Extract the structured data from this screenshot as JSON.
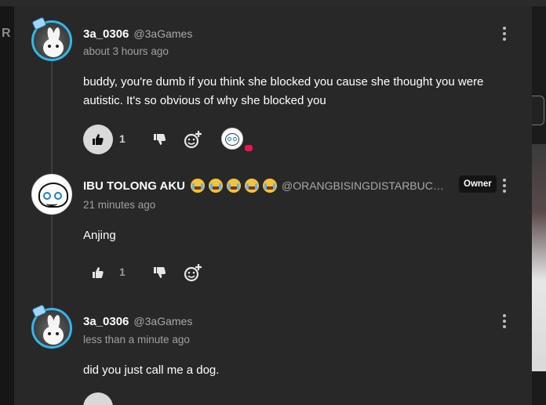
{
  "background_app": {
    "partial_letter": "R"
  },
  "comments": [
    {
      "author": "3a_0306",
      "handle": "@3aGames",
      "time": "about 3 hours ago",
      "text": "buddy, you're dumb if you think she blocked you cause she thought you were autistic. It's so obvious of why she blocked you",
      "likes": "1",
      "liked": true,
      "has_reactor": true,
      "reaction_color": "#e8174d"
    },
    {
      "author": "IBU TOLONG AKU",
      "emoji_count": 5,
      "emoji_icon": "loudly-crying-face-emoji",
      "handle": "@ORANGBISINGDISTARBUC…",
      "badge": "Owner",
      "time": "21 minutes ago",
      "text": "Anjing",
      "likes": "1",
      "liked": false
    },
    {
      "author": "3a_0306",
      "handle": "@3aGames",
      "time": "less than a minute ago",
      "text": "did you just call me a dog."
    }
  ],
  "colors": {
    "panel_bg": "#282828",
    "avatar_ring": "#35b6e8",
    "like_active_bg": "#d9d9d9",
    "muted_text": "#a8a8a8"
  }
}
